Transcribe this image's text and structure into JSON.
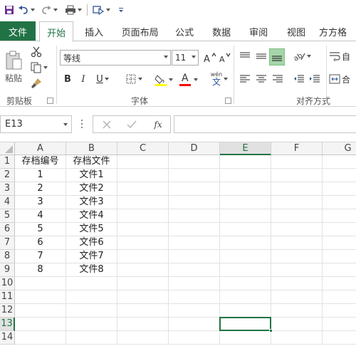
{
  "tabs": [
    "文件",
    "开始",
    "插入",
    "页面布局",
    "公式",
    "数据",
    "审阅",
    "视图",
    "方方格"
  ],
  "active_tab": 1,
  "ribbon": {
    "paste_label": "粘贴",
    "font_name": "等线",
    "font_size": "11",
    "bold": "B",
    "italic": "I",
    "underline": "U",
    "font_color_glyph": "A",
    "phonetic_top": "wén",
    "phonetic_bottom": "文",
    "groups": {
      "clipboard": "剪贴板",
      "font": "字体",
      "alignment": "对齐方式"
    },
    "cut_tail": "自",
    "merge_tail": "合",
    "accent_yellow": "#FFFF00",
    "accent_red": "#FF0000"
  },
  "formula_bar": {
    "name_box": "E13",
    "fx": "fx",
    "formula": ""
  },
  "grid": {
    "columns": [
      "A",
      "B",
      "C",
      "D",
      "E",
      "F",
      "G"
    ],
    "selected_column": "E",
    "selected_row": 13,
    "rows": [
      1,
      2,
      3,
      4,
      5,
      6,
      7,
      8,
      9,
      10,
      11,
      12,
      13,
      14
    ],
    "cells": {
      "A": [
        "存档编号",
        "1",
        "2",
        "3",
        "4",
        "5",
        "6",
        "7",
        "8",
        "",
        "",
        "",
        "",
        ""
      ],
      "B": [
        "存档文件",
        "文件1",
        "文件2",
        "文件3",
        "文件4",
        "文件5",
        "文件6",
        "文件7",
        "文件8",
        "",
        "",
        "",
        "",
        ""
      ]
    }
  },
  "colors": {
    "excel_green": "#217346"
  }
}
